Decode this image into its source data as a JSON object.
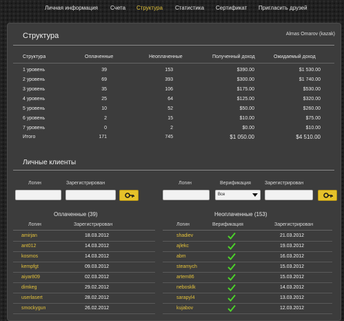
{
  "nav": {
    "items": [
      "Личная информация",
      "Счета",
      "Структура",
      "Статистика",
      "Сертификат",
      "Пригласить друзей"
    ],
    "active": "Структура",
    "active_color": "#e2c23c"
  },
  "structure": {
    "title": "Структура",
    "user": "Almas Omarov (kazak)",
    "headers": [
      "Структура",
      "Оплаченные",
      "Неоплаченные",
      "Полученный доход",
      "Ожидаемый доход"
    ],
    "rows": [
      [
        "1 уровень",
        "39",
        "153",
        "$390.00",
        "$1 530.00"
      ],
      [
        "2 уровень",
        "69",
        "393",
        "$300.00",
        "$1 740.00"
      ],
      [
        "3 уровень",
        "35",
        "106",
        "$175.00",
        "$530.00"
      ],
      [
        "4 уровень",
        "25",
        "64",
        "$125.00",
        "$320.00"
      ],
      [
        "5 уровень",
        "10",
        "52",
        "$50.00",
        "$260.00"
      ],
      [
        "6 уровень",
        "2",
        "15",
        "$10.00",
        "$75.00"
      ],
      [
        "7 уровень",
        "0",
        "2",
        "$0.00",
        "$10.00"
      ]
    ],
    "total": [
      "Итого",
      "171",
      "745",
      "$1 050.00",
      "$4 510.00"
    ]
  },
  "clients": {
    "title": "Личные клиенты",
    "filter_left": {
      "login_label": "Логин",
      "registered_label": "Зарегистрирован"
    },
    "filter_right": {
      "login_label": "Логин",
      "verification_label": "Верификация",
      "verification_value": "Все",
      "registered_label": "Зарегистрирован"
    },
    "button_color": "#e6c22a",
    "paid": {
      "title": "Оплаченные (39)",
      "headers": [
        "Логин",
        "Зарегистрирован"
      ],
      "rows": [
        [
          "amirjan",
          "18.03.2012"
        ],
        [
          "ant012",
          "14.03.2012"
        ],
        [
          "kosmos",
          "14.03.2012"
        ],
        [
          "kempfgt",
          "09.03.2012"
        ],
        [
          "aiyar809",
          "02.03.2012"
        ],
        [
          "dimkeg",
          "29.02.2012"
        ],
        [
          "userlasert",
          "28.02.2012"
        ],
        [
          "smockygun",
          "26.02.2012"
        ]
      ]
    },
    "unpaid": {
      "title": "Неоплаченные (153)",
      "headers": [
        "Логин",
        "Верификация",
        "Зарегистрирован"
      ],
      "rows": [
        [
          "shadiev",
          "21.03.2012"
        ],
        [
          "ajlekc",
          "19.03.2012"
        ],
        [
          "abm",
          "16.03.2012"
        ],
        [
          "steamych",
          "15.03.2012"
        ],
        [
          "artem86",
          "15.03.2012"
        ],
        [
          "nebosklk",
          "14.03.2012"
        ],
        [
          "sarapyl4",
          "13.03.2012"
        ],
        [
          "kujabov",
          "12.03.2012"
        ]
      ],
      "verified_icon": "checkmark-icon",
      "check_color": "#4cd12a"
    },
    "login_color": "#e3c13b"
  }
}
